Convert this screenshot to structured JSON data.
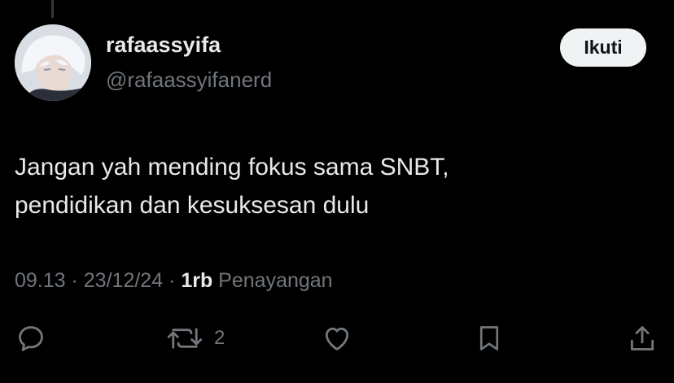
{
  "author": {
    "display_name": "rafaassyifa",
    "handle": "@rafaassyifanerd"
  },
  "follow_button_label": "Ikuti",
  "tweet": {
    "text": "Jangan yah mending fokus sama SNBT,\npendidikan dan kesuksesan dulu"
  },
  "meta": {
    "time": "09.13",
    "separator": " · ",
    "date": "23/12/24",
    "views_count": "1rb",
    "views_label": " Penayangan"
  },
  "actions": {
    "reply_icon": "reply-icon",
    "retweet_icon": "retweet-icon",
    "retweet_count": "2",
    "like_icon": "heart-icon",
    "bookmark_icon": "bookmark-icon",
    "share_icon": "share-icon"
  },
  "colors": {
    "background": "#000000",
    "primary_text": "#e7e9ea",
    "secondary_text": "#71767b",
    "follow_button_bg": "#eff3f4",
    "follow_button_text": "#0f1419"
  }
}
